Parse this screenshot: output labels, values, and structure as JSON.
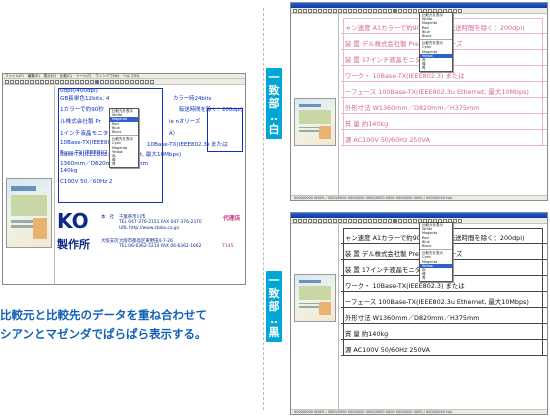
{
  "left_window": {
    "menu": [
      "ファイル(F)",
      "編集(E)",
      "表示(V)",
      "比較(C)",
      "ツール(T)",
      "ウィンドウ(W)",
      "ヘルプ(H)"
    ],
    "visible_rows": [
      "0dpi(/400dpi)",
      "GB長単色12bits, 4",
      "1カラーで約90秒",
      "ル株式会社製 Pr",
      "1インチ液晶モニタ",
      "10Base-TX(IEEE802.3)",
      "Base-TX(IEEE802.3u F",
      "1360mm／D820mm／H375mm",
      "140kg",
      "C100V 50／60Hz 2"
    ],
    "right_rows": [
      "カラー時24bits",
      "転送時間を除く：200dpi)",
      "ie nオリーズ",
      "A）"
    ],
    "overlay_rows": [
      "10Base-TX(IEEE802.3) または",
      "Base-TX(IEEE802.3u Ethernet, 最大10Mbps)"
    ],
    "side_label": "代理店",
    "company": {
      "logo": "KO",
      "name": "製作所",
      "head_office_label": "本　社",
      "head_office_address": "千葉県市川市",
      "tel": "TEL 047-376-2151",
      "fax": "FAX 047-376-2370",
      "url": "URL http://www.stoko.co.jp/",
      "branch_label": "大阪支店",
      "branch_address": "大阪市都島区東野田4-7-26",
      "branch_tel": "TEL 06-6362-5214 FAX 06-6362-1662",
      "code": "T145"
    }
  },
  "dropdown_items": [
    "比較元を表示",
    "White",
    "Magenta",
    "Red",
    "Blue",
    "Black",
    "比較先を表示",
    "Cyan",
    "Magenta",
    "Yellow",
    "赤",
    "緑",
    "青"
  ],
  "caption_line1": "比較元と比較先のデータを重ね合わせて",
  "caption_line2": "シアンとマゼンダでぱらぱら表示する。",
  "label_white": [
    "一",
    "致",
    "部",
    "‥",
    "白"
  ],
  "label_black": [
    "一",
    "致",
    "部",
    "‥",
    "黒"
  ],
  "top_right_window": {
    "rows": [
      "ャン速度 A1カラーで約90秒(データ転送時間を除く：200dpi)",
      "  装  置 デル株式会社製 Precisionシリーズ",
      "  装  置 17インチ液晶モニター(SXGA)",
      "ワーク・ 10Base-TX(IEEE802.3) または",
      "ーフェース 100Base-TX(IEEE802.3u Ethernet, 最大10Mbps)",
      "  外形寸法 W1360mm／D820mm／H375mm",
      "  質  量 約140kg",
      "  源 AC100V 50/60Hz 250VA"
    ],
    "status": "0000/0000 W000 / 0000/0000 0000/000 0000/0000 0000  0000/000 0000 / 0000/0000 Hor"
  },
  "bottom_right_window": {
    "rows": [
      "ャン速度 A1カラーで約90秒(データ転送時間を除く：200dpi)",
      "  装  置 デル株式会社製 Precisionシリーズ",
      "  装  置 17インチ液晶モニター(SXGA)",
      "ワーク・ 10Base-TX(IEEE802.3) または",
      "ーフェース 100Base-TX(IEEE802.3u Ethernet, 最大10Mbps)",
      "  外形寸法 W1360mm／D820mm／H375mm",
      "  質  量 約140kg",
      "  源 AC100V 50/60Hz 250VA"
    ],
    "status": "0000/0000 W000 / 0000/0000 0000/000 0000/0000 0000  0000/000 0000 / 0000/0000 Hor"
  },
  "colors": {
    "accent_blue": "#00a7d6",
    "caption_blue": "#1060b8",
    "magenta_text": "#c8307a",
    "black_text": "#111111",
    "left_text_blue": "#1030c0"
  }
}
